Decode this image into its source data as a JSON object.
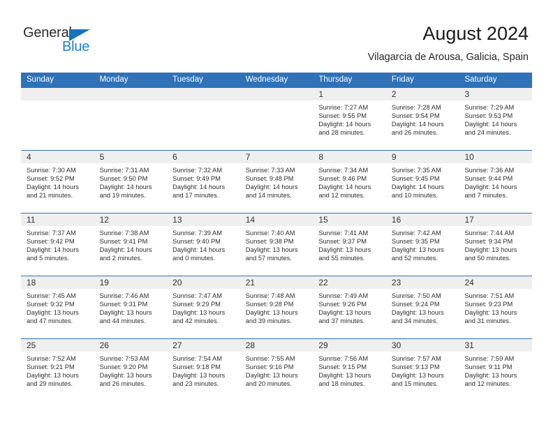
{
  "brand": {
    "name_part1": "General",
    "name_part2": "Blue",
    "triangle_color": "#1474bc",
    "blue_text_color": "#1b80cf"
  },
  "header": {
    "title": "August 2024",
    "subtitle": "Vilagarcia de Arousa, Galicia, Spain"
  },
  "theme": {
    "header_blue": "#2f72b8",
    "date_band_gray": "#efefef",
    "text_color": "#2e2e2e"
  },
  "calendar": {
    "day_names": [
      "Sunday",
      "Monday",
      "Tuesday",
      "Wednesday",
      "Thursday",
      "Friday",
      "Saturday"
    ],
    "weeks": [
      [
        {
          "date": "",
          "sunrise": "",
          "sunset": "",
          "daylight_line1": "",
          "daylight_line2": ""
        },
        {
          "date": "",
          "sunrise": "",
          "sunset": "",
          "daylight_line1": "",
          "daylight_line2": ""
        },
        {
          "date": "",
          "sunrise": "",
          "sunset": "",
          "daylight_line1": "",
          "daylight_line2": ""
        },
        {
          "date": "",
          "sunrise": "",
          "sunset": "",
          "daylight_line1": "",
          "daylight_line2": ""
        },
        {
          "date": "1",
          "sunrise": "Sunrise: 7:27 AM",
          "sunset": "Sunset: 9:55 PM",
          "daylight_line1": "Daylight: 14 hours",
          "daylight_line2": "and 28 minutes."
        },
        {
          "date": "2",
          "sunrise": "Sunrise: 7:28 AM",
          "sunset": "Sunset: 9:54 PM",
          "daylight_line1": "Daylight: 14 hours",
          "daylight_line2": "and 26 minutes."
        },
        {
          "date": "3",
          "sunrise": "Sunrise: 7:29 AM",
          "sunset": "Sunset: 9:53 PM",
          "daylight_line1": "Daylight: 14 hours",
          "daylight_line2": "and 24 minutes."
        }
      ],
      [
        {
          "date": "4",
          "sunrise": "Sunrise: 7:30 AM",
          "sunset": "Sunset: 9:52 PM",
          "daylight_line1": "Daylight: 14 hours",
          "daylight_line2": "and 21 minutes."
        },
        {
          "date": "5",
          "sunrise": "Sunrise: 7:31 AM",
          "sunset": "Sunset: 9:50 PM",
          "daylight_line1": "Daylight: 14 hours",
          "daylight_line2": "and 19 minutes."
        },
        {
          "date": "6",
          "sunrise": "Sunrise: 7:32 AM",
          "sunset": "Sunset: 9:49 PM",
          "daylight_line1": "Daylight: 14 hours",
          "daylight_line2": "and 17 minutes."
        },
        {
          "date": "7",
          "sunrise": "Sunrise: 7:33 AM",
          "sunset": "Sunset: 9:48 PM",
          "daylight_line1": "Daylight: 14 hours",
          "daylight_line2": "and 14 minutes."
        },
        {
          "date": "8",
          "sunrise": "Sunrise: 7:34 AM",
          "sunset": "Sunset: 9:46 PM",
          "daylight_line1": "Daylight: 14 hours",
          "daylight_line2": "and 12 minutes."
        },
        {
          "date": "9",
          "sunrise": "Sunrise: 7:35 AM",
          "sunset": "Sunset: 9:45 PM",
          "daylight_line1": "Daylight: 14 hours",
          "daylight_line2": "and 10 minutes."
        },
        {
          "date": "10",
          "sunrise": "Sunrise: 7:36 AM",
          "sunset": "Sunset: 9:44 PM",
          "daylight_line1": "Daylight: 14 hours",
          "daylight_line2": "and 7 minutes."
        }
      ],
      [
        {
          "date": "11",
          "sunrise": "Sunrise: 7:37 AM",
          "sunset": "Sunset: 9:42 PM",
          "daylight_line1": "Daylight: 14 hours",
          "daylight_line2": "and 5 minutes."
        },
        {
          "date": "12",
          "sunrise": "Sunrise: 7:38 AM",
          "sunset": "Sunset: 9:41 PM",
          "daylight_line1": "Daylight: 14 hours",
          "daylight_line2": "and 2 minutes."
        },
        {
          "date": "13",
          "sunrise": "Sunrise: 7:39 AM",
          "sunset": "Sunset: 9:40 PM",
          "daylight_line1": "Daylight: 14 hours",
          "daylight_line2": "and 0 minutes."
        },
        {
          "date": "14",
          "sunrise": "Sunrise: 7:40 AM",
          "sunset": "Sunset: 9:38 PM",
          "daylight_line1": "Daylight: 13 hours",
          "daylight_line2": "and 57 minutes."
        },
        {
          "date": "15",
          "sunrise": "Sunrise: 7:41 AM",
          "sunset": "Sunset: 9:37 PM",
          "daylight_line1": "Daylight: 13 hours",
          "daylight_line2": "and 55 minutes."
        },
        {
          "date": "16",
          "sunrise": "Sunrise: 7:42 AM",
          "sunset": "Sunset: 9:35 PM",
          "daylight_line1": "Daylight: 13 hours",
          "daylight_line2": "and 52 minutes."
        },
        {
          "date": "17",
          "sunrise": "Sunrise: 7:44 AM",
          "sunset": "Sunset: 9:34 PM",
          "daylight_line1": "Daylight: 13 hours",
          "daylight_line2": "and 50 minutes."
        }
      ],
      [
        {
          "date": "18",
          "sunrise": "Sunrise: 7:45 AM",
          "sunset": "Sunset: 9:32 PM",
          "daylight_line1": "Daylight: 13 hours",
          "daylight_line2": "and 47 minutes."
        },
        {
          "date": "19",
          "sunrise": "Sunrise: 7:46 AM",
          "sunset": "Sunset: 9:31 PM",
          "daylight_line1": "Daylight: 13 hours",
          "daylight_line2": "and 44 minutes."
        },
        {
          "date": "20",
          "sunrise": "Sunrise: 7:47 AM",
          "sunset": "Sunset: 9:29 PM",
          "daylight_line1": "Daylight: 13 hours",
          "daylight_line2": "and 42 minutes."
        },
        {
          "date": "21",
          "sunrise": "Sunrise: 7:48 AM",
          "sunset": "Sunset: 9:28 PM",
          "daylight_line1": "Daylight: 13 hours",
          "daylight_line2": "and 39 minutes."
        },
        {
          "date": "22",
          "sunrise": "Sunrise: 7:49 AM",
          "sunset": "Sunset: 9:26 PM",
          "daylight_line1": "Daylight: 13 hours",
          "daylight_line2": "and 37 minutes."
        },
        {
          "date": "23",
          "sunrise": "Sunrise: 7:50 AM",
          "sunset": "Sunset: 9:24 PM",
          "daylight_line1": "Daylight: 13 hours",
          "daylight_line2": "and 34 minutes."
        },
        {
          "date": "24",
          "sunrise": "Sunrise: 7:51 AM",
          "sunset": "Sunset: 9:23 PM",
          "daylight_line1": "Daylight: 13 hours",
          "daylight_line2": "and 31 minutes."
        }
      ],
      [
        {
          "date": "25",
          "sunrise": "Sunrise: 7:52 AM",
          "sunset": "Sunset: 9:21 PM",
          "daylight_line1": "Daylight: 13 hours",
          "daylight_line2": "and 29 minutes."
        },
        {
          "date": "26",
          "sunrise": "Sunrise: 7:53 AM",
          "sunset": "Sunset: 9:20 PM",
          "daylight_line1": "Daylight: 13 hours",
          "daylight_line2": "and 26 minutes."
        },
        {
          "date": "27",
          "sunrise": "Sunrise: 7:54 AM",
          "sunset": "Sunset: 9:18 PM",
          "daylight_line1": "Daylight: 13 hours",
          "daylight_line2": "and 23 minutes."
        },
        {
          "date": "28",
          "sunrise": "Sunrise: 7:55 AM",
          "sunset": "Sunset: 9:16 PM",
          "daylight_line1": "Daylight: 13 hours",
          "daylight_line2": "and 20 minutes."
        },
        {
          "date": "29",
          "sunrise": "Sunrise: 7:56 AM",
          "sunset": "Sunset: 9:15 PM",
          "daylight_line1": "Daylight: 13 hours",
          "daylight_line2": "and 18 minutes."
        },
        {
          "date": "30",
          "sunrise": "Sunrise: 7:57 AM",
          "sunset": "Sunset: 9:13 PM",
          "daylight_line1": "Daylight: 13 hours",
          "daylight_line2": "and 15 minutes."
        },
        {
          "date": "31",
          "sunrise": "Sunrise: 7:59 AM",
          "sunset": "Sunset: 9:11 PM",
          "daylight_line1": "Daylight: 13 hours",
          "daylight_line2": "and 12 minutes."
        }
      ]
    ]
  }
}
